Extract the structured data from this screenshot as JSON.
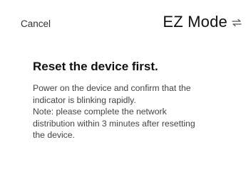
{
  "header": {
    "cancel_label": "Cancel",
    "mode_title": "EZ Mode",
    "switch_icon": "swap-arrows-icon"
  },
  "main": {
    "heading": "Reset the device first.",
    "description_lines": [
      "Power on the device and confirm that the",
      "indicator is blinking rapidly.",
      "Note: please complete the network",
      "distribution within 3 minutes after resetting",
      "the device."
    ]
  },
  "colors": {
    "background": "#ffffff",
    "heading_text": "#111111",
    "body_text": "#444444"
  }
}
